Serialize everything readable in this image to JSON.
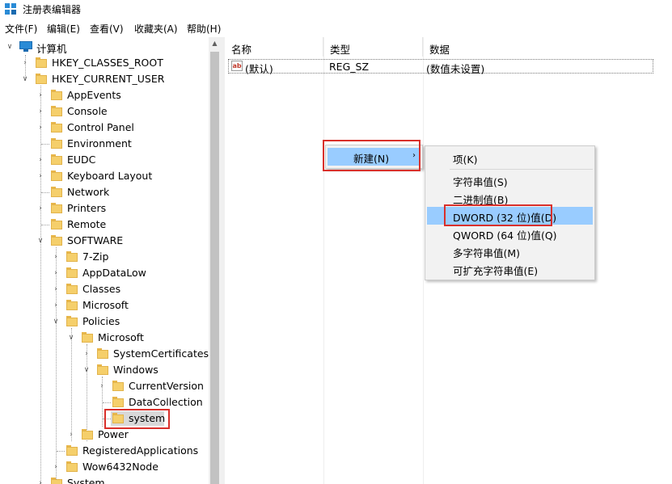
{
  "window": {
    "title": "注册表编辑器"
  },
  "menubar": [
    "文件(F)",
    "编辑(E)",
    "查看(V)",
    "收藏夹(A)",
    "帮助(H)"
  ],
  "tree": {
    "root": "计算机",
    "nodes": [
      "HKEY_CLASSES_ROOT",
      "HKEY_CURRENT_USER",
      "AppEvents",
      "Console",
      "Control Panel",
      "Environment",
      "EUDC",
      "Keyboard Layout",
      "Network",
      "Printers",
      "Remote",
      "SOFTWARE",
      "7-Zip",
      "AppDataLow",
      "Classes",
      "Microsoft",
      "Policies",
      "Microsoft",
      "SystemCertificates",
      "Windows",
      "CurrentVersion",
      "DataCollection",
      "system",
      "Power",
      "RegisteredApplications",
      "Wow6432Node",
      "System"
    ],
    "selected": "system"
  },
  "list": {
    "columns": [
      "名称",
      "类型",
      "数据"
    ],
    "rows": [
      {
        "name": "(默认)",
        "type": "REG_SZ",
        "data": "(数值未设置)"
      }
    ]
  },
  "context_menu": {
    "item": "新建(N)"
  },
  "submenu": {
    "items": [
      "项(K)",
      "字符串值(S)",
      "二进制值(B)",
      "DWORD (32 位)值(D)",
      "QWORD (64 位)值(Q)",
      "多字符串值(M)",
      "可扩充字符串值(E)"
    ],
    "highlighted": "DWORD (32 位)值(D)"
  },
  "colors": {
    "highlight": "#99ccff",
    "annotation": "#d9302b",
    "folder": "#f5cf6b"
  }
}
